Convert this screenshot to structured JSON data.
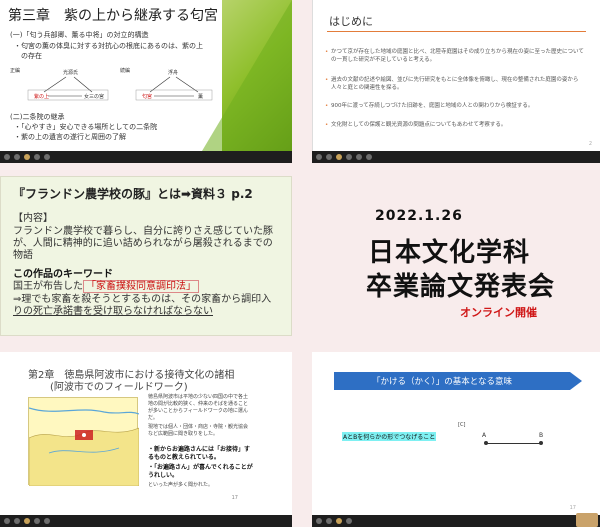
{
  "colors": {
    "background": "#f8ecec",
    "accent_green": "#6fae1e",
    "accent_orange": "#e37c3a",
    "banner_blue": "#2e6fc4",
    "red_text": "#d01818",
    "highlight_cyan": "#7ef0f2"
  },
  "panel1": {
    "title": "第三章　紫の上から継承する匂宮",
    "heading1": "(一)「匂う兵部卿、薫る中将」の対立的構造",
    "bullet1a": "・匂宮の薫の体臭に対する対抗心の根底にあるのは、紫の上",
    "bullet1b": "　の存在",
    "diagram": {
      "left_label": "正編",
      "left_top": "光源氏",
      "left_bl": "紫の上",
      "left_br": "女三の宮",
      "right_label": "続編",
      "right_top": "浮舟",
      "right_bl": "匂宮",
      "right_br": "薫"
    },
    "heading2": "(二)二条院の継承",
    "bullet2a": "・「心やすき」安心できる場所としての二条院",
    "bullet2b": "・紫の上の遺言の遂行と周囲の了解"
  },
  "panel2": {
    "title": "はじめに",
    "bullets": [
      "かつて京が存在した地域の庭園と比べ、北陸寺庭園はその成り立ちから現在の姿に至った歴史についての一貫した研究が不足していると考える。",
      "過去の文献の記述や絵図、並びに先行研究をもとに全体像を俯瞰し、現在の整備された庭園の姿から人々と庭との関連性を探る。",
      "900年に渡って存続しつづけた旧跡を、庭園と地域の人との関わりから検証する。",
      "文化財としての保護と観光資源の問題点についてもあわせて考察する。"
    ],
    "page_number": "2"
  },
  "panel3": {
    "title": "『フランドン農学校の豚』とは➡資料３ p.2",
    "content_label": "【内容】",
    "content_lines": [
      "フランドン農学校で暮らし、自分に誇りさえ感じていた豚",
      "が、人間に精神的に追い詰められながら屠殺されるまでの",
      "物語"
    ],
    "keyword_heading": "この作品のキーワード",
    "keyword_line_prefix": "国王が布告した",
    "keyword_highlight": "「家畜撲殺同意調印法」",
    "implication_line1": "⇒理でも家畜を殺そうとするものは、その家畜から調印入",
    "implication_line2": "りの死亡承諾書を受け取らなければならない"
  },
  "announcement": {
    "date": "2022.1.26",
    "line1": "日本文化学科",
    "line2": "卒業論文発表会",
    "subtitle": "オンライン開催"
  },
  "panel4": {
    "title": "第2章　徳島県阿波市における接待文化の諸相",
    "subtitle": "(阿波市でのフィールドワーク)",
    "paragraph1": "徳島県阿波市は平地の少ない四国の中で各土地の間が比較的狭く、仲来のそばを通ることが多いことからフィールドワークの地に選んだ。",
    "paragraph2": "現地では個人・団体・商店・寺院・観光協会など広範囲に聞き取りをした。",
    "quote1": "・新からお遍路さんには「お接待」するものと教えられている。",
    "quote2": "・「お遍路さん」が喜んでくれることがうれしい。",
    "closing": "といった声が多く聞かれた。",
    "page_number": "17"
  },
  "panel5": {
    "banner": "「かける（かく）」の基本となる意味",
    "figure_label": "[C]",
    "highlight": "AとBを何らかの形でつなげること",
    "point_a": "A",
    "point_b": "B",
    "page_number": "17"
  }
}
